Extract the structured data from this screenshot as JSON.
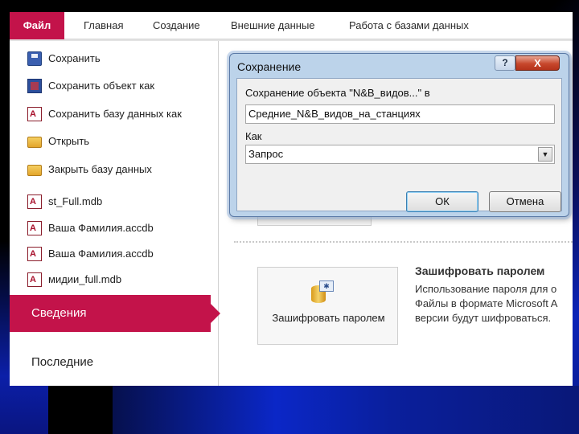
{
  "ribbon": {
    "tabs": [
      "Файл",
      "Главная",
      "Создание",
      "Внешние данные",
      "Работа с базами данных"
    ]
  },
  "menu": {
    "items": [
      {
        "label": "Сохранить",
        "icon": "save-icon"
      },
      {
        "label": "Сохранить объект как",
        "icon": "save-object-icon"
      },
      {
        "label": "Сохранить базу данных как",
        "icon": "access-db-icon"
      },
      {
        "label": "Открыть",
        "icon": "folder-open-icon"
      },
      {
        "label": "Закрыть базу данных",
        "icon": "folder-close-icon"
      },
      {
        "label": "st_Full.mdb",
        "icon": "access-db-icon"
      },
      {
        "label": "Ваша Фамилия.accdb",
        "icon": "access-db-icon"
      },
      {
        "label": "Ваша Фамилия.accdb",
        "icon": "access-db-icon"
      },
      {
        "label": "мидии_full.mdb",
        "icon": "access-db-icon"
      }
    ],
    "selected": "Сведения",
    "recent": "Последние"
  },
  "dialog": {
    "title": "Сохранение",
    "help_label": "?",
    "close_label": "X",
    "save_object_label": "Сохранение объекта \"N&B_видов...\" в",
    "name_value": "Средние_N&B_видов_на_станциях",
    "as_label": "Как",
    "as_value": "Запрос",
    "ok_label": "ОК",
    "cancel_label": "Отмена"
  },
  "content": {
    "encrypt_button_label": "Зашифровать паролем",
    "encrypt_title": "Зашифровать паролем",
    "encrypt_desc_lines": [
      "Использование пароля для о",
      "Файлы в формате Microsoft A",
      "версии будут шифроваться."
    ]
  },
  "colors": {
    "accent": "#c3134a",
    "dialog_frame": "#bcd3ea"
  }
}
